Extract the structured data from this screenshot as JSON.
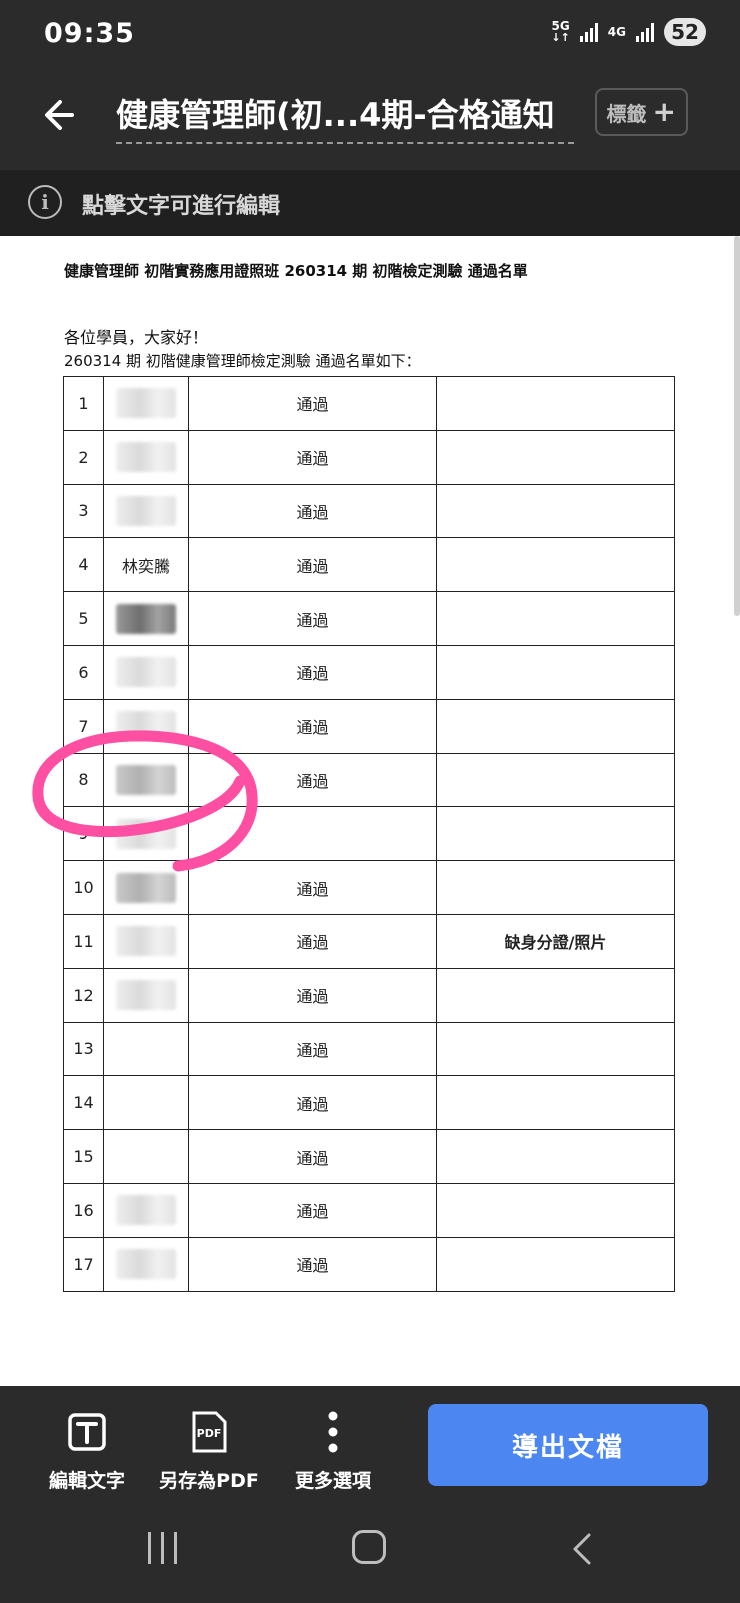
{
  "status_bar": {
    "time": "09:35",
    "network1": "5G",
    "network2": "4G",
    "battery": "52"
  },
  "app_bar": {
    "back_icon": "arrow-left-icon",
    "title": "健康管理師(初...4期-合格通知",
    "tag_button": "標籤"
  },
  "info_bar": {
    "icon": "info-icon",
    "text": "點擊文字可進行編輯"
  },
  "document": {
    "heading": "健康管理師  初階實務應用證照班  260314 期 初階檢定測驗  通過名單",
    "greeting": "各位學員，大家好！",
    "intro": "260314 期  初階健康管理師檢定測驗   通過名單如下：",
    "rows": [
      {
        "no": "1",
        "name": "",
        "name_style": "light",
        "status": "通過",
        "note": ""
      },
      {
        "no": "2",
        "name": "",
        "name_style": "light",
        "status": "通過",
        "note": ""
      },
      {
        "no": "3",
        "name": "",
        "name_style": "light",
        "status": "通過",
        "note": ""
      },
      {
        "no": "4",
        "name": "林奕騰",
        "name_style": "text",
        "status": "通過",
        "note": ""
      },
      {
        "no": "5",
        "name": "",
        "name_style": "dark",
        "status": "通過",
        "note": ""
      },
      {
        "no": "6",
        "name": "",
        "name_style": "light",
        "status": "通過",
        "note": ""
      },
      {
        "no": "7",
        "name": "",
        "name_style": "light",
        "status": "通過",
        "note": ""
      },
      {
        "no": "8",
        "name": "",
        "name_style": "mid",
        "status": "通過",
        "note": ""
      },
      {
        "no": "9",
        "name": "",
        "name_style": "light",
        "status": "",
        "note": ""
      },
      {
        "no": "10",
        "name": "",
        "name_style": "mid",
        "status": "通過",
        "note": ""
      },
      {
        "no": "11",
        "name": "",
        "name_style": "light",
        "status": "通過",
        "note": "缺身分證/照片"
      },
      {
        "no": "12",
        "name": "",
        "name_style": "light",
        "status": "通過",
        "note": ""
      },
      {
        "no": "13",
        "name": "",
        "name_style": "none",
        "status": "通過",
        "note": ""
      },
      {
        "no": "14",
        "name": "",
        "name_style": "none",
        "status": "通過",
        "note": ""
      },
      {
        "no": "15",
        "name": "",
        "name_style": "none",
        "status": "通過",
        "note": ""
      },
      {
        "no": "16",
        "name": "",
        "name_style": "light",
        "status": "通過",
        "note": ""
      },
      {
        "no": "17",
        "name": "",
        "name_style": "light",
        "status": "通過",
        "note": ""
      }
    ],
    "highlight_color": "#ff4fa3"
  },
  "toolbar": {
    "edit_text": "編輯文字",
    "save_pdf": "另存為PDF",
    "pdf_badge": "PDF",
    "more": "更多選項",
    "export": "導出文檔",
    "export_color": "#4c86f0"
  }
}
